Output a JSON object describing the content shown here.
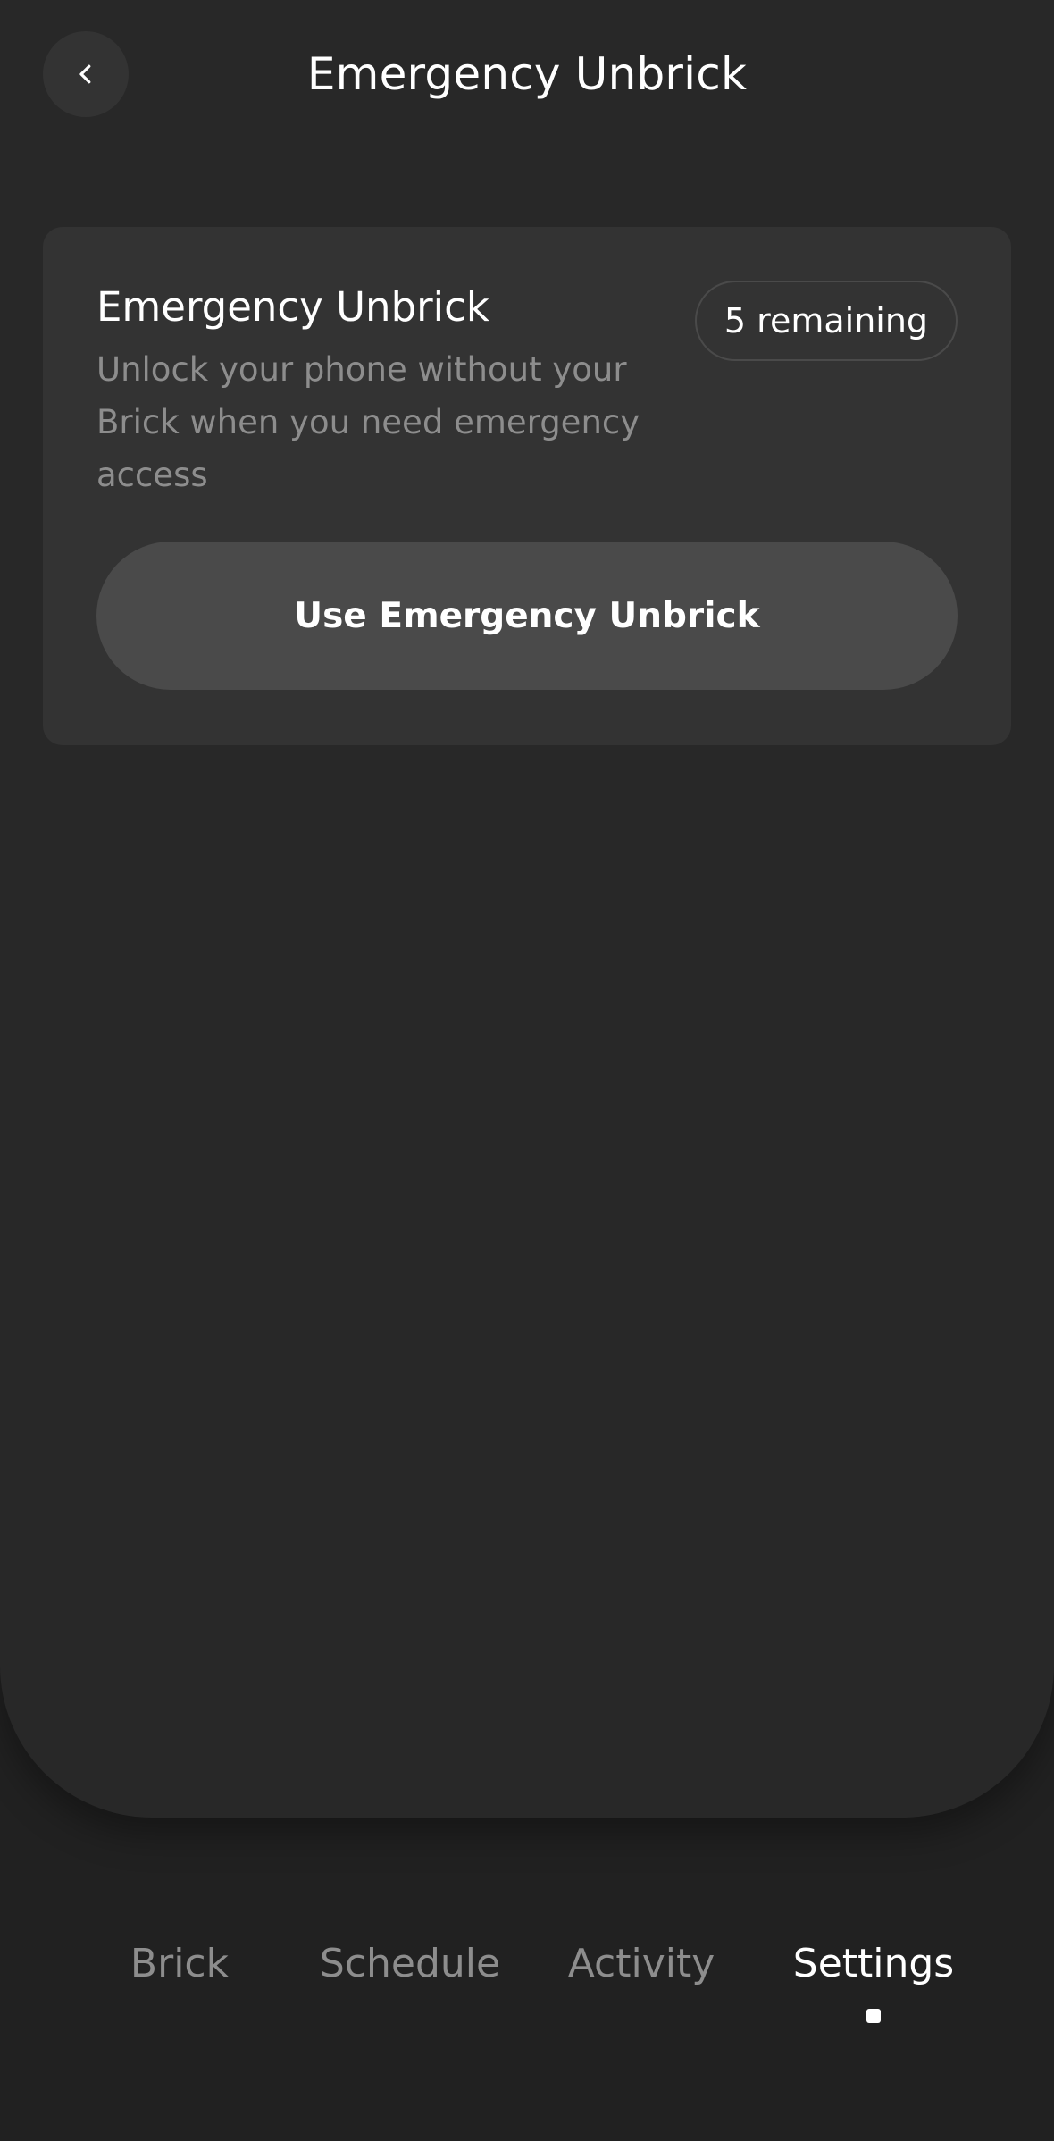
{
  "header": {
    "title": "Emergency Unbrick",
    "back_icon": "chevron-left-icon"
  },
  "card": {
    "title": "Emergency Unbrick",
    "description": "Unlock your phone without your Brick when you need emergency access",
    "badge": "5 remaining",
    "button_label": "Use Emergency Unbrick"
  },
  "nav": {
    "items": [
      {
        "label": "Brick",
        "active": false
      },
      {
        "label": "Schedule",
        "active": false
      },
      {
        "label": "Activity",
        "active": false
      },
      {
        "label": "Settings",
        "active": true
      }
    ]
  },
  "colors": {
    "background": "#212121",
    "panel": "#282828",
    "card": "#333333",
    "button": "#4a4a4a",
    "text_primary": "#ffffff",
    "text_secondary": "#8d8d8d"
  }
}
